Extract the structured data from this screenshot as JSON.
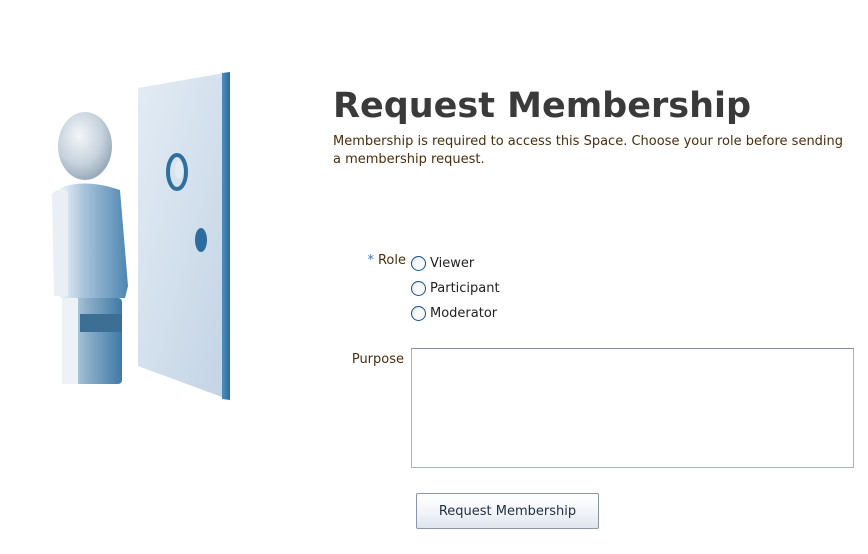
{
  "header": {
    "title": "Request Membership",
    "intro": "Membership is required to access this Space. Choose your role before sending a membership request."
  },
  "form": {
    "role": {
      "required_mark": "*",
      "label": "Role",
      "options": [
        "Viewer",
        "Participant",
        "Moderator"
      ],
      "selected": null
    },
    "purpose": {
      "label": "Purpose",
      "value": ""
    },
    "submit_label": "Request Membership"
  },
  "colors": {
    "title": "#3a3a3a",
    "label_text": "#4a2e0e",
    "required_mark": "#3d73c4",
    "field_border": "#a7b3c3"
  },
  "icons": {
    "illustration": "person-at-door-icon"
  }
}
